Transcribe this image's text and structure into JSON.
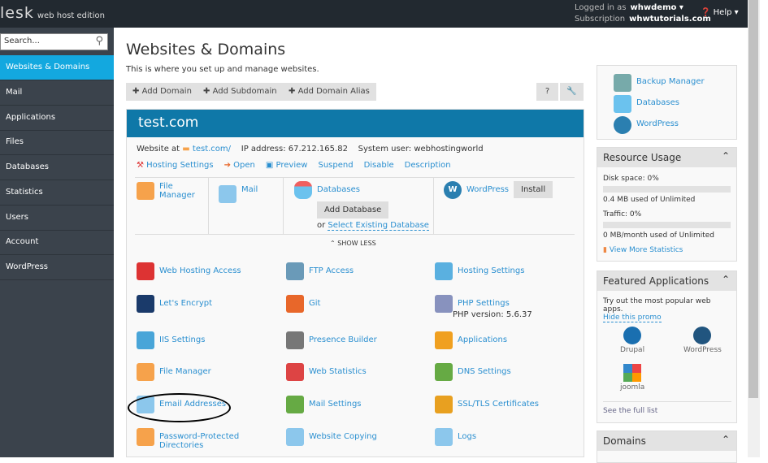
{
  "header": {
    "logo": "lesk",
    "edition": "web host edition",
    "logged_label": "Logged in as",
    "user": "whwdemo ▾",
    "sub_label": "Subscription",
    "subscription": "whwtutorials.com",
    "help": "Help ▾"
  },
  "sidebar": {
    "search_placeholder": "Search...",
    "items": [
      {
        "label": "Websites & Domains"
      },
      {
        "label": "Mail"
      },
      {
        "label": "Applications"
      },
      {
        "label": "Files"
      },
      {
        "label": "Databases"
      },
      {
        "label": "Statistics"
      },
      {
        "label": "Users"
      },
      {
        "label": "Account"
      },
      {
        "label": "WordPress"
      }
    ]
  },
  "page": {
    "title": "Websites & Domains",
    "subtitle": "This is where you set up and manage websites.",
    "toolbar": [
      "Add Domain",
      "Add Subdomain",
      "Add Domain Alias"
    ]
  },
  "domain": {
    "name": "test.com",
    "website_label": "Website at",
    "url": "test.com/",
    "ip_label": "IP address:",
    "ip": "67.212.165.82",
    "user_label": "System user:",
    "user": "webhostingworld",
    "actions": [
      "Hosting Settings",
      "Open",
      "Preview",
      "Suspend",
      "Disable",
      "Description"
    ],
    "file_manager": "File Manager",
    "mail": "Mail",
    "databases": "Databases",
    "add_database": "Add Database",
    "or": "or",
    "select_db": "Select Existing Database",
    "wordpress": "WordPress",
    "install": "Install",
    "show_less": "SHOW LESS",
    "tools": [
      {
        "label": "Web Hosting Access",
        "color": "#d33"
      },
      {
        "label": "FTP Access",
        "color": "#6a9ab8"
      },
      {
        "label": "Hosting Settings",
        "color": "#5ab0e0"
      },
      {
        "label": "Let's Encrypt",
        "color": "#1a3a6a"
      },
      {
        "label": "Git",
        "color": "#e8672a"
      },
      {
        "label": "PHP Settings",
        "color": "#8892be"
      },
      {
        "label": "IIS Settings",
        "color": "#49a5d8"
      },
      {
        "label": "Presence Builder",
        "color": "#777"
      },
      {
        "label": "Applications",
        "color": "#f0a020"
      },
      {
        "label": "File Manager",
        "color": "#f6a24b"
      },
      {
        "label": "Web Statistics",
        "color": "#d44"
      },
      {
        "label": "DNS Settings",
        "color": "#6a4"
      },
      {
        "label": "Email Addresses",
        "color": "#8cc7ec"
      },
      {
        "label": "Mail Settings",
        "color": "#6a4"
      },
      {
        "label": "SSL/TLS Certificates",
        "color": "#e8a020"
      },
      {
        "label": "Password-Protected Directories",
        "color": "#f6a24b"
      },
      {
        "label": "Website Copying",
        "color": "#8cc7ec"
      },
      {
        "label": "Logs",
        "color": "#8cc7ec"
      }
    ],
    "php_version": "PHP version: 5.6.37"
  },
  "right": {
    "links": [
      "Backup Manager",
      "Databases",
      "WordPress"
    ],
    "resource": {
      "title": "Resource Usage",
      "disk": "Disk space: 0%",
      "disk_pct": 0,
      "disk_used": "0.4 MB used of Unlimited",
      "traffic": "Traffic: 0%",
      "traffic_pct": 0,
      "traffic_used": "0 MB/month used of Unlimited",
      "more": "View More Statistics"
    },
    "featured": {
      "title": "Featured Applications",
      "text": "Try out the most popular web apps.",
      "hide": "Hide this promo",
      "apps": [
        "Drupal",
        "WordPress",
        "joomla"
      ],
      "full": "See the full list"
    },
    "domains": {
      "title": "Domains"
    }
  }
}
